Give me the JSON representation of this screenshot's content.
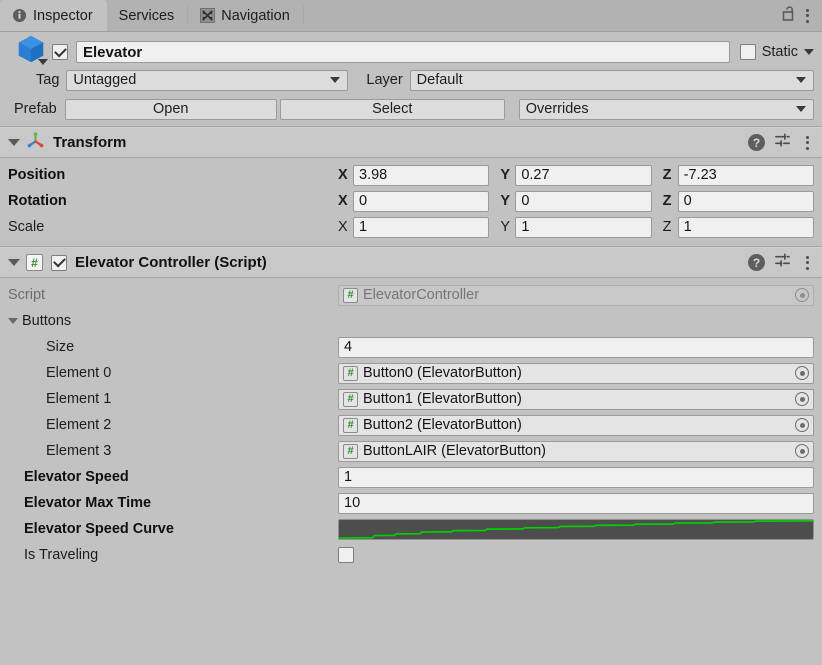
{
  "window": {
    "tabs": [
      {
        "label": "Inspector",
        "icon": "info-icon",
        "active": true
      },
      {
        "label": "Services",
        "icon": null,
        "active": false
      },
      {
        "label": "Navigation",
        "icon": "navigation-expand-icon",
        "active": false
      }
    ],
    "lock_icon": "unlocked-padlock-icon",
    "menu_icon": "kebab-menu-icon"
  },
  "gameobject": {
    "icon": "prefab-cube-icon",
    "enabled": true,
    "name": "Elevator",
    "static_checked": false,
    "static_label": "Static",
    "tag_label": "Tag",
    "tag_value": "Untagged",
    "layer_label": "Layer",
    "layer_value": "Default",
    "prefab_label": "Prefab",
    "prefab_open": "Open",
    "prefab_select": "Select",
    "prefab_overrides": "Overrides"
  },
  "transform": {
    "title": "Transform",
    "icon": "transform-axis-icon",
    "help_icon": "help-icon",
    "preset_icon": "preset-settings-icon",
    "menu_icon": "kebab-menu-icon",
    "rows": [
      {
        "label": "Position",
        "bold": true,
        "x": "3.98",
        "y": "0.27",
        "z": "-7.23"
      },
      {
        "label": "Rotation",
        "bold": true,
        "x": "0",
        "y": "0",
        "z": "0"
      },
      {
        "label": "Scale",
        "bold": false,
        "x": "1",
        "y": "1",
        "z": "1"
      }
    ],
    "axis_labels": {
      "x": "X",
      "y": "Y",
      "z": "Z"
    }
  },
  "script_component": {
    "icon": "csharp-script-icon",
    "enabled": true,
    "title": "Elevator Controller (Script)",
    "help_icon": "help-icon",
    "preset_icon": "preset-settings-icon",
    "menu_icon": "kebab-menu-icon",
    "script_row": {
      "label": "Script",
      "value": "ElevatorController"
    },
    "buttons_array": {
      "label": "Buttons",
      "size_label": "Size",
      "size_value": "4",
      "elements": [
        {
          "label": "Element 0",
          "value": "Button0 (ElevatorButton)"
        },
        {
          "label": "Element 1",
          "value": "Button1 (ElevatorButton)"
        },
        {
          "label": "Element 2",
          "value": "Button2 (ElevatorButton)"
        },
        {
          "label": "Element 3",
          "value": "ButtonLAIR (ElevatorButton)"
        }
      ]
    },
    "speed": {
      "label": "Elevator Speed",
      "value": "1"
    },
    "max_time": {
      "label": "Elevator Max Time",
      "value": "10"
    },
    "speed_curve": {
      "label": "Elevator Speed Curve",
      "curve_color": "#00d000"
    },
    "is_traveling": {
      "label": "Is Traveling",
      "checked": false
    }
  },
  "colors": {
    "background": "#c2c2c2",
    "tabstrip": "#b2b2b2",
    "component_header": "#c8c8c8",
    "field": "#f0f0f0",
    "curve_background": "#4d4d4d",
    "curve_line": "#00d000",
    "prefab_blue": "#2a7fd4"
  }
}
